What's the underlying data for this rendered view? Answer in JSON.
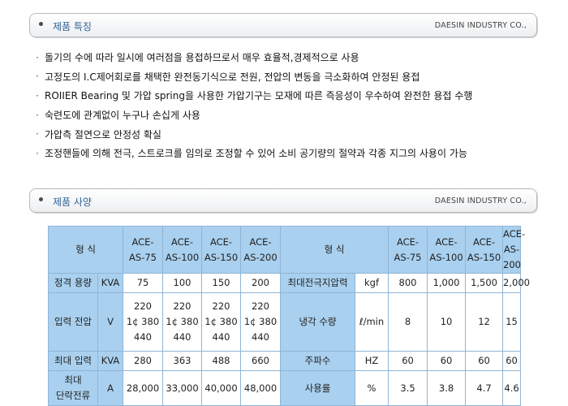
{
  "features_section": {
    "title": "제품 특징",
    "company": "DAESIN INDUSTRY CO.,",
    "bullet_mark": "·",
    "items": [
      "돌기의 수에 따라 일시에 여러점을 용접하므로서 매우 효율적,경제적으로 사용",
      "고정도의 I.C제어회로를 채택한 완전동기식으로 전원, 전압의 변동을 극소화하여 안정된 용접",
      "ROIIER Bearing 및 가압 spring을 사용한 가압기구는 모재에 따른 즉응성이 우수하여 완전한 용접 수행",
      "숙련도에 관계없이 누구나 손십게 사용",
      "가압측 절연으로 안정성 확실",
      "조정핸들에 의해 전극, 스트로크를 임의로 조정할 수 있어 소비 공기량의 절약과 각종 지그의 사용이 가능"
    ]
  },
  "spec_section": {
    "title": "제품 사양",
    "company": "DAESIN INDUSTRY CO.,"
  },
  "spec_table": {
    "left_header": "형 식",
    "right_header": "형 식",
    "models": [
      [
        "ACE-",
        "AS-75"
      ],
      [
        "ACE-",
        "AS-100"
      ],
      [
        "ACE-",
        "AS-150"
      ],
      [
        "ACE-",
        "AS-200"
      ]
    ],
    "left_rows": [
      {
        "label": [
          "정격 용량"
        ],
        "unit": "KVA",
        "values": [
          [
            "75"
          ],
          [
            "100"
          ],
          [
            "150"
          ],
          [
            "200"
          ]
        ]
      },
      {
        "label": [
          "입력 전압"
        ],
        "unit": "V",
        "values": [
          [
            "220",
            "1¢ 380",
            "440"
          ],
          [
            "220",
            "1¢ 380",
            "440"
          ],
          [
            "220",
            "1¢ 380",
            "440"
          ],
          [
            "220",
            "1¢ 380",
            "440"
          ]
        ]
      },
      {
        "label": [
          "최대 입력"
        ],
        "unit": "KVA",
        "values": [
          [
            "280"
          ],
          [
            "363"
          ],
          [
            "488"
          ],
          [
            "660"
          ]
        ]
      },
      {
        "label": [
          "최대",
          "단락전류"
        ],
        "unit": "A",
        "values": [
          [
            "28,000"
          ],
          [
            "33,000"
          ],
          [
            "40,000"
          ],
          [
            "48,000"
          ]
        ]
      }
    ],
    "right_rows": [
      {
        "label": "최대전극지압력",
        "unit": "kgf",
        "values": [
          "800",
          "1,000",
          "1,500",
          "2,000"
        ]
      },
      {
        "label": "냉각 수량",
        "unit": "ℓ/min",
        "values": [
          "8",
          "10",
          "12",
          "15"
        ]
      },
      {
        "label": "주파수",
        "unit": "HZ",
        "values": [
          "60",
          "60",
          "60",
          "60"
        ]
      },
      {
        "label": "사용률",
        "unit": "%",
        "values": [
          "3.5",
          "3.8",
          "4.7",
          "4.6"
        ]
      }
    ]
  },
  "colors": {
    "header_fill": "#a9d0ef",
    "cell_border": "#8fb5d6",
    "section_title": "#2f5f93"
  }
}
